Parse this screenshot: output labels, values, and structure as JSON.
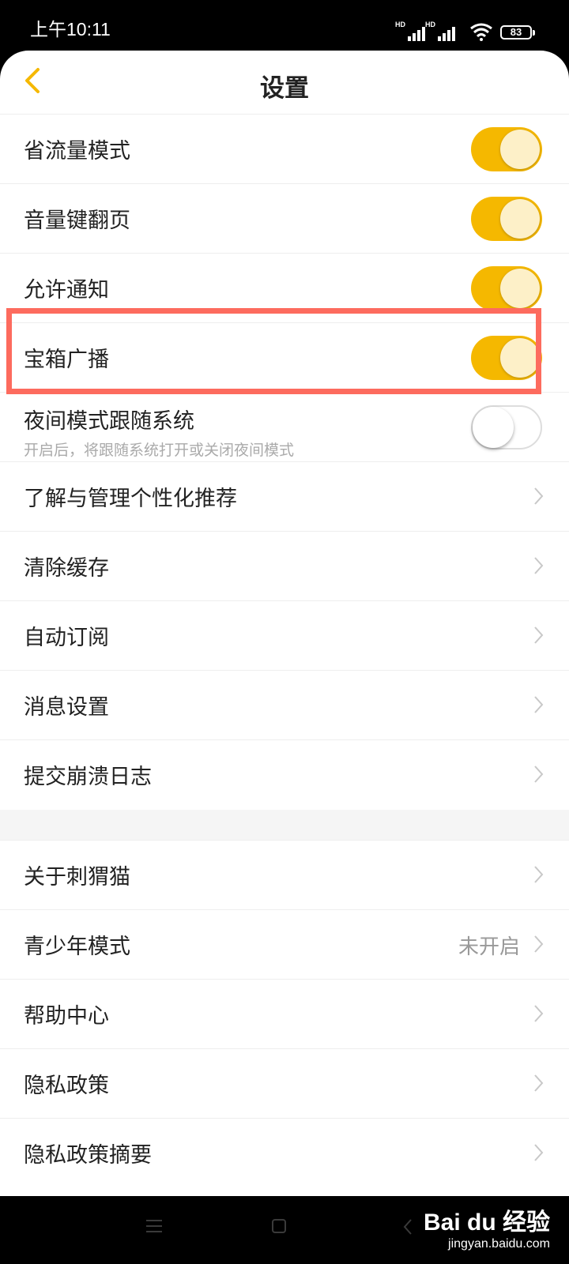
{
  "status_bar": {
    "time": "上午10:11",
    "network_label_1": "HD",
    "network_label_2": "HD",
    "battery": "83"
  },
  "header": {
    "title": "设置",
    "back_icon": "chevron-left-icon"
  },
  "colors": {
    "accent": "#f5b800",
    "knob_on": "#fdf0c8",
    "highlight_box": "#fd6b5e"
  },
  "toggles": [
    {
      "label": "省流量模式",
      "on": true
    },
    {
      "label": "音量键翻页",
      "on": true
    },
    {
      "label": "允许通知",
      "on": true
    },
    {
      "label": "宝箱广播",
      "on": true
    },
    {
      "label": "夜间模式跟随系统",
      "sublabel": "开启后，将跟随系统打开或关闭夜间模式",
      "on": false
    }
  ],
  "menu_group_1": [
    {
      "label": "了解与管理个性化推荐"
    },
    {
      "label": "清除缓存"
    },
    {
      "label": "自动订阅"
    },
    {
      "label": "消息设置"
    },
    {
      "label": "提交崩溃日志"
    }
  ],
  "menu_group_2": [
    {
      "label": "关于刺猬猫"
    },
    {
      "label": "青少年模式",
      "value": "未开启"
    },
    {
      "label": "帮助中心"
    },
    {
      "label": "隐私政策"
    },
    {
      "label": "隐私政策摘要"
    }
  ],
  "watermark": {
    "main": "Bai du 经验",
    "sub": "jingyan.baidu.com"
  }
}
